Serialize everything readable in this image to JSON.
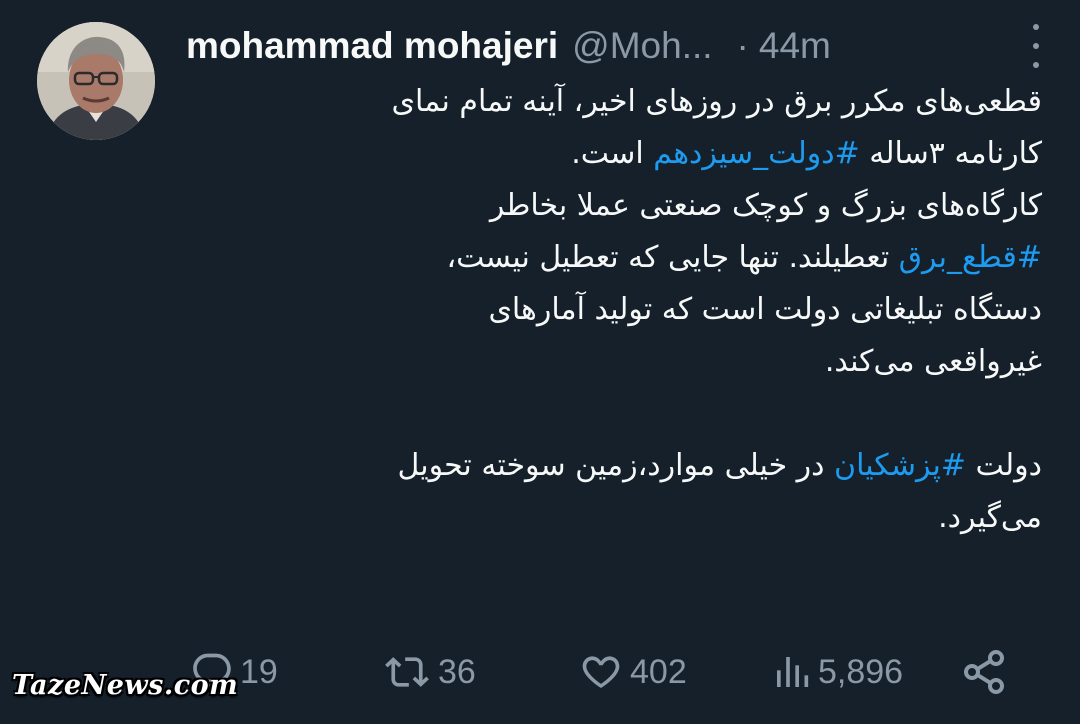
{
  "author": {
    "name": "mohammad mohajeri",
    "handle": "@Moh...",
    "separator": "·",
    "time": "44m"
  },
  "tweet": {
    "line1": "قطعی‌های مکرر برق در روزهای اخیر، آینه تمام نمای",
    "line2_prefix": "کارنامه ۳ساله ",
    "line2_tag": "#دولت_سیزدهم",
    "line2_suffix": " است.",
    "line3": "کارگاه‌های بزرگ و کوچک صنعتی  عملا بخاطر",
    "line4_tag": "#قطع_برق",
    "line4_suffix": " تعطیلند. تنها جایی که تعطیل نیست،",
    "line5": "دستگاه تبلیغاتی دولت است که تولید آمارهای",
    "line6": "غیرواقعی می‌کند.",
    "line7_prefix": "دولت ",
    "line7_tag": "#پزشکیان",
    "line7_suffix": " در خیلی موارد،زمین سوخته تحویل",
    "line8": "می‌گیرد."
  },
  "actions": {
    "replies": "19",
    "retweets": "36",
    "likes": "402",
    "views": "5,896"
  },
  "icons": {
    "reply": "reply-icon",
    "retweet": "retweet-icon",
    "like": "heart-icon",
    "views": "views-icon",
    "share": "share-icon",
    "more": "more-icon"
  },
  "colors": {
    "background": "#15202b",
    "text": "#f7f9f9",
    "muted": "#8b98a5",
    "hashtag": "#1d9bf0"
  },
  "watermark": "TazeNews.com"
}
